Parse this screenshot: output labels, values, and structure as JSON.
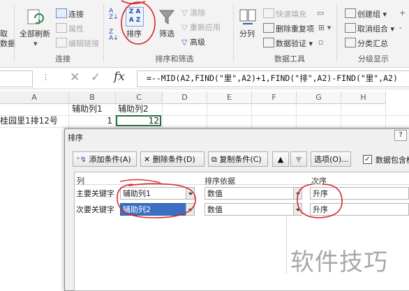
{
  "ribbon": {
    "left_partial_1": "取",
    "left_partial_2": "数据",
    "refresh_all": "全部刷新",
    "connections": "连接",
    "properties": "属性",
    "edit_links": "编辑链接",
    "group_connections": "连接",
    "sort": "排序",
    "filter": "筛选",
    "clear": "清除",
    "reapply": "重新应用",
    "advanced": "高级",
    "group_sort_filter": "排序和筛选",
    "split": "分列",
    "flash_fill": "快速填充",
    "remove_duplicates": "删除重复项",
    "data_validation": "数据验证",
    "group_data_tools": "数据工具",
    "group": "创建组",
    "ungroup": "取消组合",
    "subtotal": "分类汇总",
    "group_outline": "分级显示"
  },
  "formula_bar": {
    "formula": "=--MID(A2,FIND(\"里\",A2)+1,FIND(\"排\",A2)-FIND(\"里\",A2)"
  },
  "sheet": {
    "columns": [
      "A",
      "B",
      "C",
      "D",
      "E",
      "F",
      "G",
      "H"
    ],
    "row1": {
      "b": "辅助列1",
      "c": "辅助列2"
    },
    "row2": {
      "a": "桂园里1排12号",
      "b": "1",
      "c": "12"
    }
  },
  "dialog": {
    "title": "排序",
    "help": "?",
    "add_level": "添加条件(A)",
    "delete_level": "删除条件(D)",
    "copy_level": "复制条件(C)",
    "options": "选项(O)...",
    "has_headers": "数据包含标",
    "col_header_column": "列",
    "col_header_sort_on": "排序依据",
    "col_header_order": "次序",
    "rows": [
      {
        "label": "主要关键字",
        "column": "辅助列1",
        "sort_on": "数值",
        "order": "升序"
      },
      {
        "label": "次要关键字",
        "column": "辅助列2",
        "sort_on": "数值",
        "order": "升序"
      }
    ]
  },
  "watermark": "软件技巧"
}
